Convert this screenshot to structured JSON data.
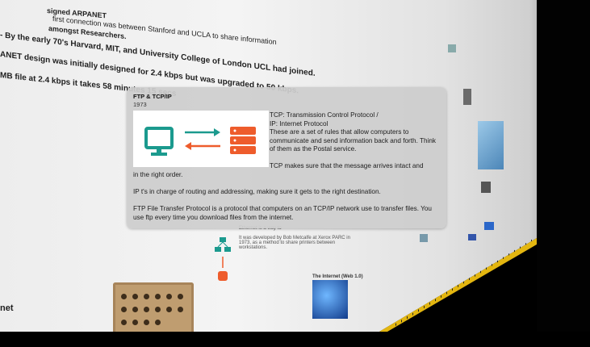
{
  "background": {
    "lines": [
      "first connection was between Stanford and UCLA to share information",
      "- By the early 70's Harvard, MIT, and University College of London UCL had joined.",
      "ANET design was initially designed for 2.4 kbps but was upgraded to 50 kbps.",
      "MB file at 2.4 kbps it takes 58 minutes 15 secs",
      "amongst Researchers.",
      "signed ARPANET",
      "Ethernet is a way to",
      "It was developed by Bob Metcalfe at Xerox PARC in 1973, as a method to share printers between workstations.",
      "The Internet (Web 1.0)",
      "net"
    ]
  },
  "card": {
    "title": "FTP & TCP/IP",
    "year": "1973",
    "para1_line1": "TCP: Transmission Control Protocol /",
    "para1_line2": "IP: Internet Protocol",
    "para1_body": "These are a set of rules that allow computers to communicate and send information back and forth. Think of them as the Postal service.",
    "para2_a": "TCP makes sure that the message arrives intact and",
    "para2_b": "in the right order.",
    "para3": "IP t's in charge of routing and addressing, making sure it gets to the right destination.",
    "para4": "FTP File Transfer Protocol is a protocol that computers on an TCP/IP network use to transfer files. You use ftp every time you download files from the internet."
  },
  "colors": {
    "computer": "#1b9a8e",
    "server": "#ee5c2c",
    "ruler": "#e3b610"
  }
}
